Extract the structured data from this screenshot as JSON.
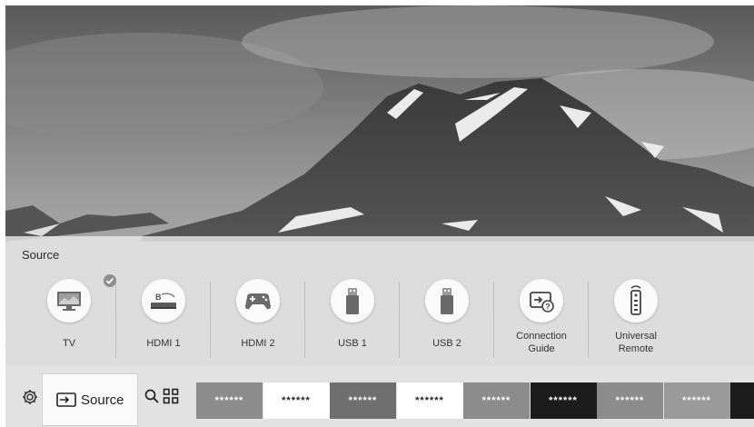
{
  "panel": {
    "title": "Source"
  },
  "sources": [
    {
      "label": "TV",
      "icon": "tv-icon",
      "connected": true
    },
    {
      "label": "HDMI 1",
      "icon": "bluray-player-icon",
      "connected": false
    },
    {
      "label": "HDMI 2",
      "icon": "game-console-icon",
      "connected": false
    },
    {
      "label": "USB 1",
      "icon": "usb-drive-icon",
      "connected": false
    },
    {
      "label": "USB 2",
      "icon": "usb-drive-icon",
      "connected": false
    },
    {
      "label": "Connection\nGuide",
      "icon": "connection-guide-icon",
      "connected": false
    },
    {
      "label": "Universal\nRemote",
      "icon": "remote-control-icon",
      "connected": false
    }
  ],
  "bottom_bar": {
    "settings_icon": "gear-icon",
    "source_button": {
      "label": "Source",
      "icon": "source-input-icon"
    },
    "search_icon": "search-icon",
    "apps_icon": "apps-grid-icon"
  },
  "tiles": [
    {
      "label": "******",
      "bg": "#8c8c8c",
      "fg": "#ffffff"
    },
    {
      "label": "******",
      "bg": "#ffffff",
      "fg": "#222222"
    },
    {
      "label": "******",
      "bg": "#6f6f6f",
      "fg": "#ffffff"
    },
    {
      "label": "******",
      "bg": "#ffffff",
      "fg": "#222222"
    },
    {
      "label": "******",
      "bg": "#8c8c8c",
      "fg": "#ffffff"
    },
    {
      "label": "******",
      "bg": "#1c1c1c",
      "fg": "#ffffff"
    },
    {
      "label": "******",
      "bg": "#8c8c8c",
      "fg": "#ffffff"
    },
    {
      "label": "******",
      "bg": "#9a9a9a",
      "fg": "#ffffff"
    },
    {
      "label": "**",
      "bg": "#1c1c1c",
      "fg": "#ffffff"
    }
  ]
}
